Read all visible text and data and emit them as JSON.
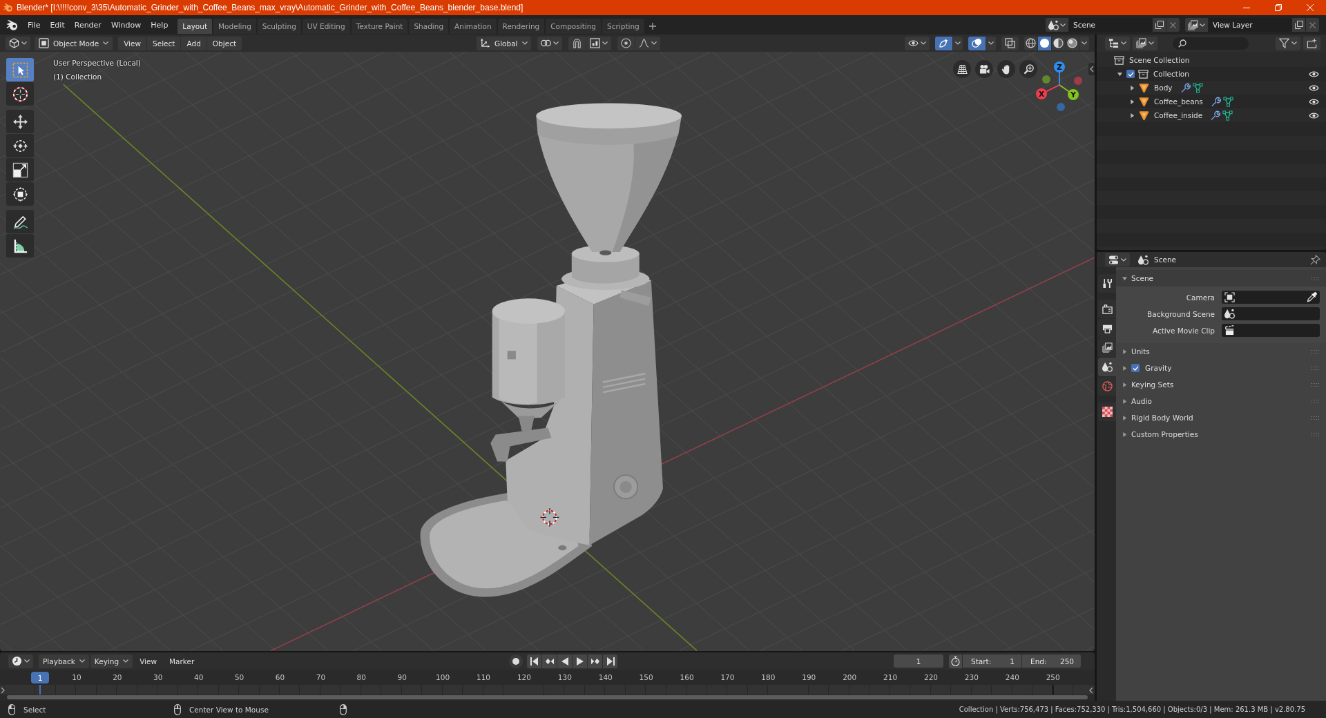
{
  "window": {
    "title": "Blender* [I:\\!!!!conv_3\\35\\Automatic_Grinder_with_Coffee_Beans_max_vray\\Automatic_Grinder_with_Coffee_Beans_blender_base.blend]"
  },
  "menu_bar": {
    "menus": [
      "File",
      "Edit",
      "Render",
      "Window",
      "Help"
    ],
    "workspaces": [
      {
        "label": "Layout",
        "selected": true
      },
      {
        "label": "Modeling",
        "selected": false
      },
      {
        "label": "Sculpting",
        "selected": false
      },
      {
        "label": "UV Editing",
        "selected": false
      },
      {
        "label": "Texture Paint",
        "selected": false
      },
      {
        "label": "Shading",
        "selected": false
      },
      {
        "label": "Animation",
        "selected": false
      },
      {
        "label": "Rendering",
        "selected": false
      },
      {
        "label": "Compositing",
        "selected": false
      },
      {
        "label": "Scripting",
        "selected": false
      }
    ],
    "scene": "Scene",
    "view_layer": "View Layer"
  },
  "viewport": {
    "header": {
      "mode": "Object Mode",
      "menus": [
        "View",
        "Select",
        "Add",
        "Object"
      ],
      "orientation": "Global",
      "toggles": [
        {
          "kind": "gizmos",
          "on": true
        },
        {
          "kind": "overlays",
          "on": true
        },
        {
          "kind": "xray",
          "on": false
        }
      ],
      "shading": [
        {
          "kind": "wireframe",
          "selected": false
        },
        {
          "kind": "solid",
          "selected": true
        },
        {
          "kind": "material",
          "selected": false
        },
        {
          "kind": "rendered",
          "selected": false
        }
      ]
    },
    "overlay_text": [
      "User Perspective (Local)",
      "(1) Collection"
    ],
    "tool_groups": [
      [
        {
          "kind": "select_box",
          "selected": true
        },
        {
          "kind": "cursor",
          "selected": false
        }
      ],
      [
        {
          "kind": "move",
          "selected": false
        },
        {
          "kind": "rotate",
          "selected": false
        },
        {
          "kind": "scale",
          "selected": false
        },
        {
          "kind": "transform",
          "selected": false
        }
      ],
      [
        {
          "kind": "annotate",
          "selected": false
        },
        {
          "kind": "measure",
          "selected": false
        }
      ]
    ],
    "gizmo_axes": [
      {
        "label": "X",
        "color": "#f03c50"
      },
      {
        "label": "Y",
        "color": "#82c31e"
      },
      {
        "label": "Z",
        "color": "#2f8cf0"
      }
    ]
  },
  "outliner": {
    "tree": [
      {
        "kind": "scene_collection",
        "name": "Scene Collection",
        "children": [
          {
            "kind": "collection",
            "name": "Collection",
            "expanded": true,
            "checked": true,
            "visible": true,
            "children": [
              {
                "kind": "mesh",
                "name": "Body",
                "expanded": false,
                "visible": true
              },
              {
                "kind": "mesh",
                "name": "Coffee_beans",
                "expanded": false,
                "visible": true
              },
              {
                "kind": "mesh",
                "name": "Coffee_inside",
                "expanded": false,
                "visible": true
              }
            ]
          }
        ]
      }
    ]
  },
  "properties": {
    "context": "Scene",
    "tab_groups": [
      [
        {
          "kind": "tool",
          "selected": false
        }
      ],
      [
        {
          "kind": "render",
          "selected": false
        },
        {
          "kind": "output",
          "selected": false
        },
        {
          "kind": "view_layer",
          "selected": false
        },
        {
          "kind": "scene",
          "selected": true
        },
        {
          "kind": "world",
          "selected": false
        }
      ],
      [
        {
          "kind": "texture",
          "selected": false
        }
      ]
    ],
    "panels": [
      {
        "title": "Scene",
        "expanded": true,
        "fields": [
          {
            "kind": "camera",
            "label": "Camera"
          },
          {
            "kind": "scene",
            "label": "Background Scene"
          },
          {
            "kind": "movie_clip",
            "label": "Active Movie Clip"
          }
        ]
      },
      {
        "title": "Units",
        "expanded": false
      },
      {
        "title": "Gravity",
        "expanded": false,
        "checkbox": {
          "checked": true
        }
      },
      {
        "title": "Keying Sets",
        "expanded": false
      },
      {
        "title": "Audio",
        "expanded": false
      },
      {
        "title": "Rigid Body World",
        "expanded": false
      },
      {
        "title": "Custom Properties",
        "expanded": false
      }
    ]
  },
  "timeline": {
    "menus": [
      {
        "kind": "dropdown",
        "label": "Playback"
      },
      {
        "kind": "dropdown",
        "label": "Keying"
      },
      {
        "kind": "menu",
        "label": "View"
      },
      {
        "kind": "menu",
        "label": "Marker"
      }
    ],
    "current_frame": "1",
    "start": {
      "label": "Start:",
      "value": "1"
    },
    "end": {
      "label": "End:",
      "value": "250"
    },
    "playhead": "1",
    "ruler": [
      "10",
      "20",
      "30",
      "40",
      "50",
      "60",
      "70",
      "80",
      "90",
      "100",
      "110",
      "120",
      "130",
      "140",
      "150",
      "160",
      "170",
      "180",
      "190",
      "200",
      "210",
      "220",
      "230",
      "240",
      "250"
    ]
  },
  "status_bar": {
    "hints": [
      {
        "kind": "left_click",
        "label": "Select"
      },
      {
        "kind": "middle_click",
        "label": "Center View to Mouse"
      },
      {
        "kind": "right_click"
      }
    ],
    "stats": "Collection | Verts:756,473 | Faces:752,330 | Tris:1,504,660 | Objects:0/3 | Mem: 261.3 MB | v2.80.75"
  }
}
